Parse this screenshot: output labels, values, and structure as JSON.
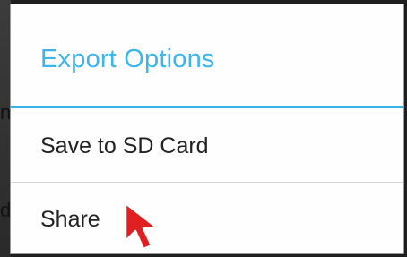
{
  "dialog": {
    "title": "Export Options",
    "title_color": "#3db5e6",
    "items": [
      {
        "label": "Save to SD Card"
      },
      {
        "label": "Share"
      }
    ]
  },
  "background": {
    "partial_chars": [
      "n",
      "d"
    ]
  },
  "cursor": {
    "icon": "arrow-pointer-icon",
    "color": "#e02020"
  }
}
